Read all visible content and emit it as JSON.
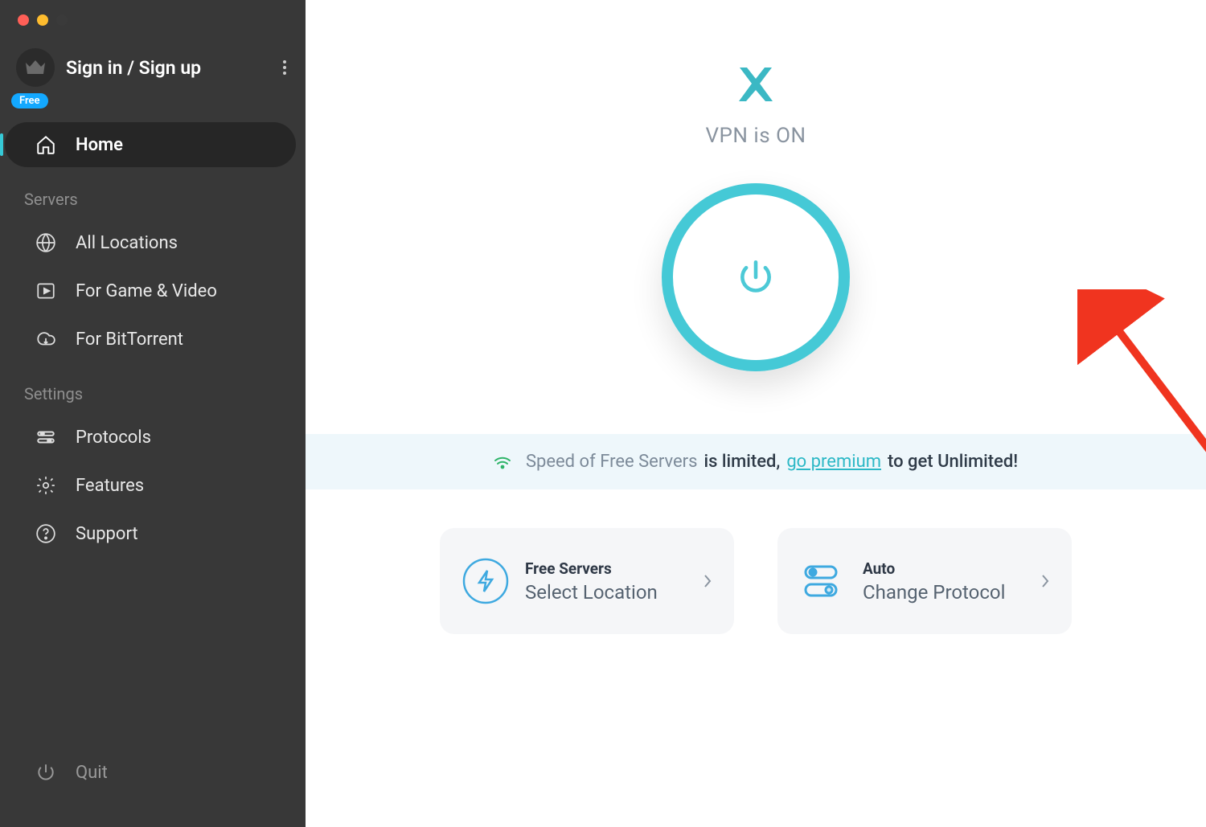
{
  "account": {
    "signin_label": "Sign in / Sign up",
    "badge": "Free"
  },
  "sidebar": {
    "home": "Home",
    "servers_label": "Servers",
    "all_locations": "All Locations",
    "game_video": "For Game & Video",
    "bittorrent": "For BitTorrent",
    "settings_label": "Settings",
    "protocols": "Protocols",
    "features": "Features",
    "support": "Support",
    "quit": "Quit"
  },
  "main": {
    "status": "VPN is ON"
  },
  "banner": {
    "prefix": "Speed of Free Servers ",
    "bold": "is limited, ",
    "link": "go premium",
    "suffix": " to get Unlimited!"
  },
  "cards": {
    "servers": {
      "title": "Free Servers",
      "sub": "Select Location"
    },
    "protocol": {
      "title": "Auto",
      "sub": "Change Protocol"
    }
  },
  "colors": {
    "accent": "#45c9d6",
    "sidebar": "#383838",
    "banner_bg": "#eef7fb"
  }
}
